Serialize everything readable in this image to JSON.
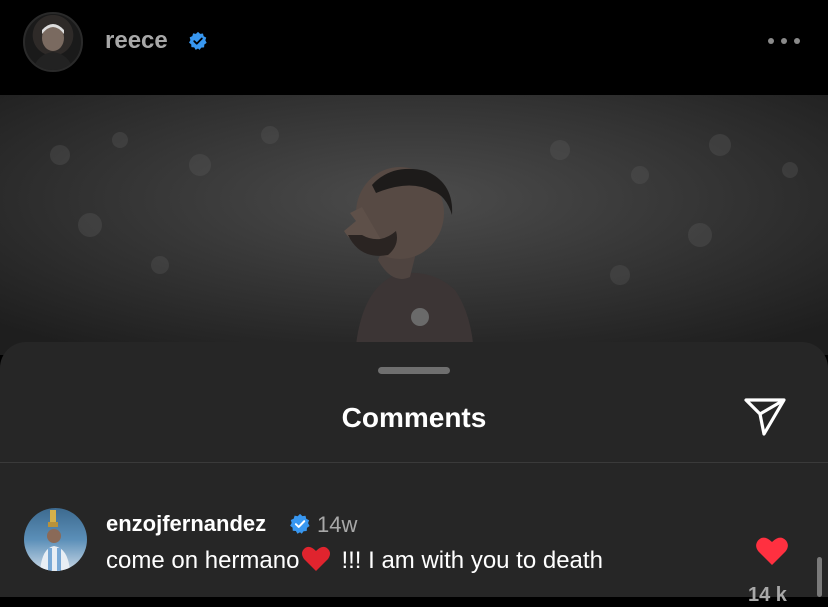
{
  "header": {
    "username": "reece",
    "verified": true,
    "more_icon": "more-horizontal-icon"
  },
  "post": {
    "image_description_icon": "photo"
  },
  "comments_sheet": {
    "title": "Comments",
    "send_icon": "send-icon",
    "comments": [
      {
        "username": "enzojfernandez",
        "verified": true,
        "time": "14w",
        "text_before": "come on hermano",
        "text_after": "!!! I am with you to death",
        "like_count": "14 k",
        "liked": true
      }
    ]
  },
  "colors": {
    "background": "#000000",
    "sheet": "#262626",
    "verified": "#3897f0",
    "like": "#ff3040",
    "secondary_text": "#a8a8a8"
  }
}
